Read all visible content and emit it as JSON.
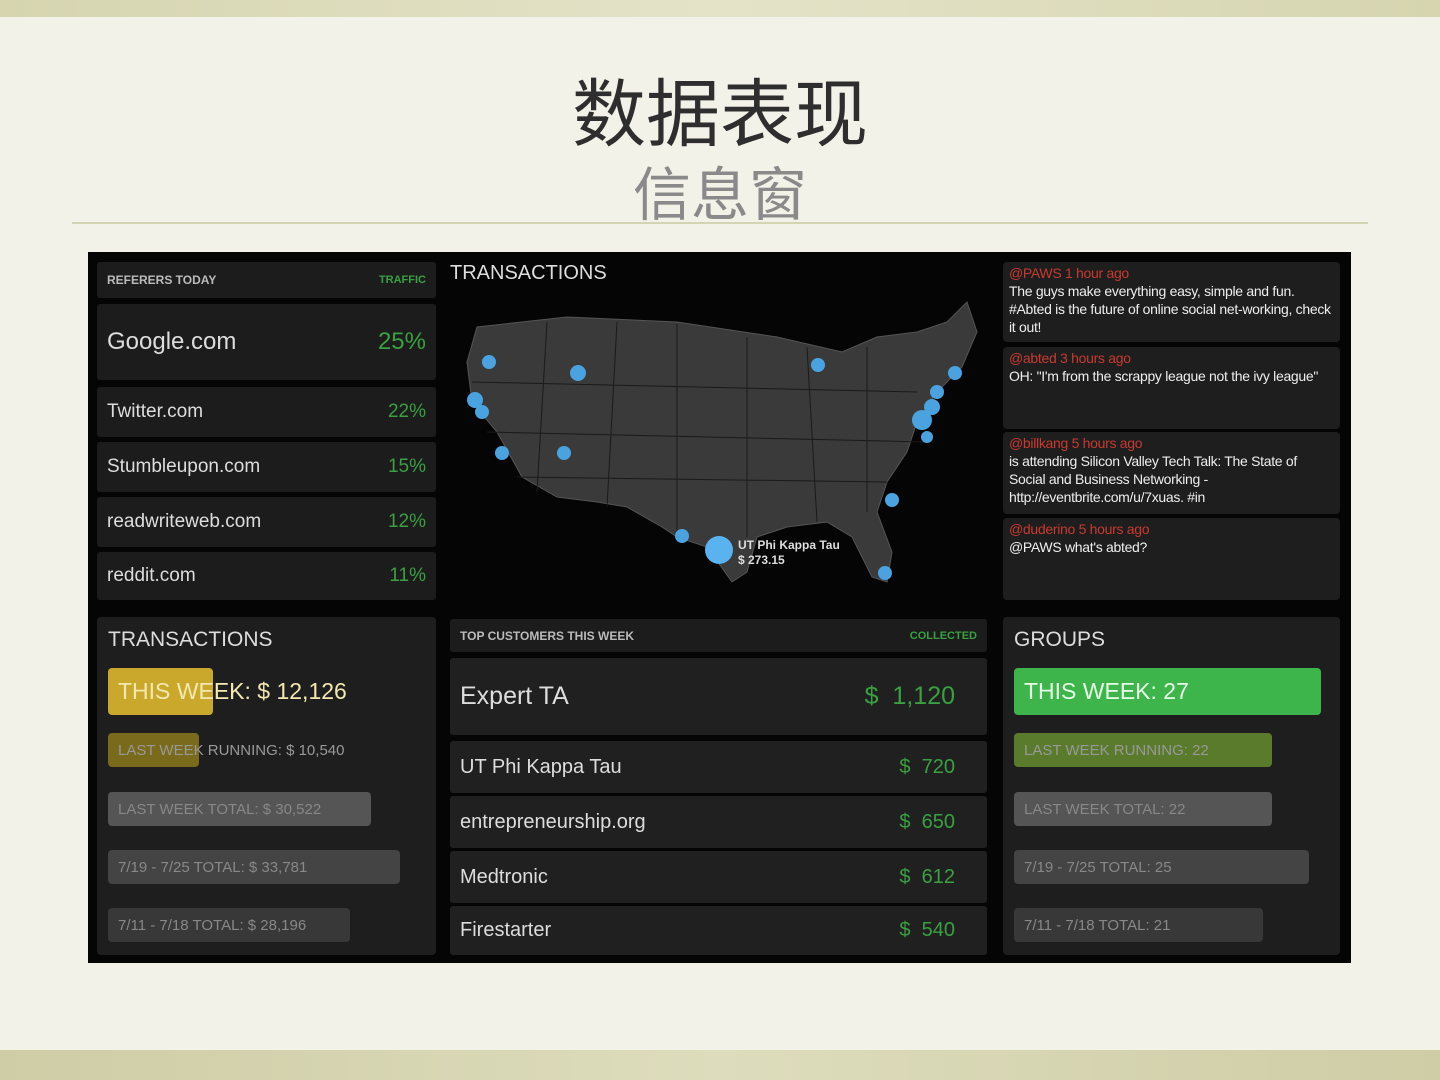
{
  "slide": {
    "title": "数据表现",
    "subtitle": "信息窗"
  },
  "referrers": {
    "header": "REFERERS TODAY",
    "col": "TRAFFIC",
    "items": [
      {
        "site": "Google.com",
        "pct": "25%"
      },
      {
        "site": "Twitter.com",
        "pct": "22%"
      },
      {
        "site": "Stumbleupon.com",
        "pct": "15%"
      },
      {
        "site": "readwriteweb.com",
        "pct": "12%"
      },
      {
        "site": "reddit.com",
        "pct": "11%"
      }
    ]
  },
  "map": {
    "title": "TRANSACTIONS",
    "callout_name": "UT Phi Kappa Tau",
    "callout_amount": "$ 273.15"
  },
  "tweets": [
    {
      "head": "@PAWS 1 hour ago",
      "body": "The guys make everything easy, simple and fun. #Abted is the future of online social net-working, check it out!"
    },
    {
      "head": "@abted 3 hours ago",
      "body": "OH: \"I'm from the scrappy league not the ivy league\""
    },
    {
      "head": "@billkang 5 hours ago",
      "body": "is attending Silicon Valley Tech Talk: The State of Social and Business Networking - http://eventbrite.com/u/7xuas. #in"
    },
    {
      "head": "@duderino 5 hours ago",
      "body": "@PAWS what's abted?"
    }
  ],
  "transactions": {
    "title": "TRANSACTIONS",
    "bars": [
      {
        "label": "THIS WEEK: $ 12,126",
        "fill": 0.36
      },
      {
        "label": "LAST WEEK RUNNING: $ 10,540",
        "fill": 0.31
      },
      {
        "label": "LAST WEEK TOTAL: $ 30,522",
        "fill": 0.9
      },
      {
        "label": "7/19 - 7/25 TOTAL: $ 33,781",
        "fill": 1.0
      },
      {
        "label": "7/11 - 7/18 TOTAL: $ 28,196",
        "fill": 0.83
      }
    ]
  },
  "customers": {
    "header": "TOP CUSTOMERS THIS WEEK",
    "col": "COLLECTED",
    "items": [
      {
        "name": "Expert TA",
        "amount": "$  1,120"
      },
      {
        "name": "UT Phi Kappa Tau",
        "amount": "$  720"
      },
      {
        "name": "entrepreneurship.org",
        "amount": "$  650"
      },
      {
        "name": "Medtronic",
        "amount": "$  612"
      },
      {
        "name": "Firestarter",
        "amount": "$  540"
      }
    ]
  },
  "groups": {
    "title": "GROUPS",
    "bars": [
      {
        "label": "THIS WEEK: 27",
        "fill": 1.0
      },
      {
        "label": "LAST WEEK RUNNING: 22",
        "fill": 0.84
      },
      {
        "label": "LAST WEEK TOTAL: 22",
        "fill": 0.84
      },
      {
        "label": "7/19 - 7/25 TOTAL: 25",
        "fill": 0.96
      },
      {
        "label": "7/11 - 7/18 TOTAL: 21",
        "fill": 0.81
      }
    ]
  },
  "colors": {
    "yellow": "#c9a82c",
    "yellow_dark": "#7a6a1c",
    "green": "#3db54a",
    "green_dark": "#5a7b2c",
    "dot": "#4aa3df"
  }
}
